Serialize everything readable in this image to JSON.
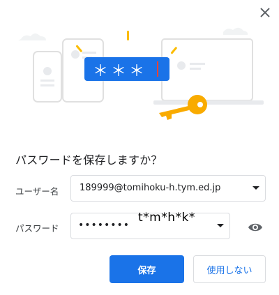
{
  "dialog": {
    "close_icon": "close-icon",
    "title": "パスワードを保存しますか？",
    "illustration": {
      "masked_text": "＊＊＊",
      "key_color": "#f9ab00",
      "accent_color": "#1a73e8"
    },
    "username": {
      "label": "ユーザー名",
      "value": "189999@tomihoku-h.tym.ed.jp"
    },
    "password": {
      "label": "パスワード",
      "masked_value": "••••••••",
      "overlay_text": "t*m*h*k*",
      "show_icon": "eye-icon"
    },
    "buttons": {
      "save_label": "保存",
      "never_label": "使用しない"
    }
  }
}
